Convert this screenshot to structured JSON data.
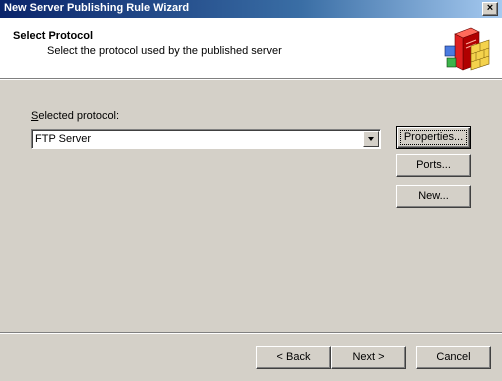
{
  "window": {
    "title": "New Server Publishing Rule Wizard",
    "close_label": "×"
  },
  "header": {
    "title": "Select Protocol",
    "subtitle": "Select the protocol used by the published server",
    "icon": "server-firewall-icon"
  },
  "form": {
    "protocol_label": "Selected protocol:",
    "protocol_label_accesskey": "S",
    "protocol_label_rest": "elected protocol:",
    "protocol_value": "FTP Server"
  },
  "side_buttons": {
    "properties": "Properties...",
    "ports": "Ports...",
    "new": "New..."
  },
  "nav_buttons": {
    "back": "< Back",
    "next": "Next >",
    "cancel": "Cancel"
  },
  "colors": {
    "titlebar_start": "#0a246a",
    "titlebar_end": "#a6caf0",
    "face": "#d4d0c8"
  }
}
